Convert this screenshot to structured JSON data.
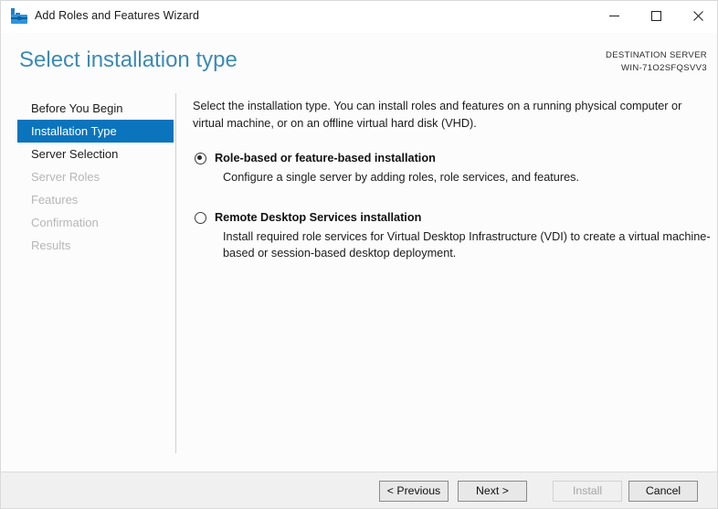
{
  "window": {
    "title": "Add Roles and Features Wizard",
    "icon": "wizard-toolbox-icon",
    "controls": {
      "minimize": "Minimize",
      "maximize": "Maximize",
      "close": "Close"
    }
  },
  "header": {
    "page_title": "Select installation type",
    "destination_label": "DESTINATION SERVER",
    "destination_server": "WIN-71O2SFQSVV3",
    "title_color": "#3d8ab4"
  },
  "sidebar": {
    "selected_index": 1,
    "highlight_color": "#0a74bd",
    "items": [
      {
        "label": "Before You Begin",
        "state": "enabled"
      },
      {
        "label": "Installation Type",
        "state": "selected"
      },
      {
        "label": "Server Selection",
        "state": "enabled"
      },
      {
        "label": "Server Roles",
        "state": "disabled"
      },
      {
        "label": "Features",
        "state": "disabled"
      },
      {
        "label": "Confirmation",
        "state": "disabled"
      },
      {
        "label": "Results",
        "state": "disabled"
      }
    ]
  },
  "main": {
    "intro": "Select the installation type. You can install roles and features on a running physical computer or virtual machine, or on an offline virtual hard disk (VHD).",
    "options": [
      {
        "title": "Role-based or feature-based installation",
        "description": "Configure a single server by adding roles, role services, and features.",
        "selected": true
      },
      {
        "title": "Remote Desktop Services installation",
        "description": "Install required role services for Virtual Desktop Infrastructure (VDI) to create a virtual machine-based or session-based desktop deployment.",
        "selected": false
      }
    ]
  },
  "footer": {
    "previous_label": "< Previous",
    "next_label": "Next >",
    "install_label": "Install",
    "cancel_label": "Cancel",
    "install_enabled": false
  }
}
